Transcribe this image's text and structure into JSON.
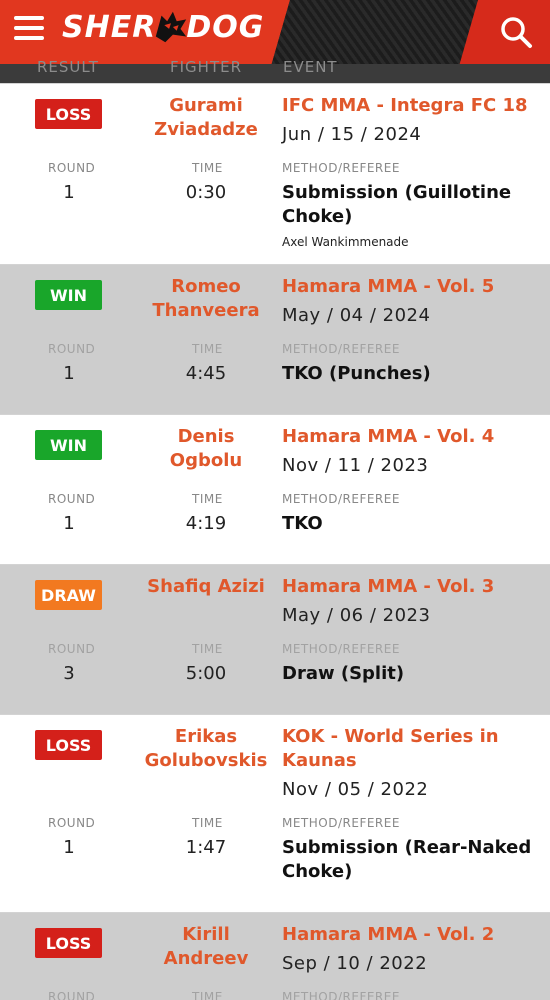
{
  "header": {
    "logo_left": "SHER",
    "logo_right": "DOG",
    "column_labels": [
      "RESULT",
      "FIGHTER",
      "EVENT"
    ]
  },
  "labels": {
    "round": "ROUND",
    "time": "TIME",
    "method_referee": "METHOD/REFEREE"
  },
  "colors": {
    "brand_red": "#e1371f",
    "loss": "#d4201a",
    "win": "#19a62a",
    "draw": "#f27920",
    "link_orange": "#e0582b"
  },
  "fights": [
    {
      "result": "LOSS",
      "fighter": "Gurami Zviadadze",
      "event": "IFC MMA - Integra FC 18",
      "date": "Jun / 15 / 2024",
      "round": "1",
      "time": "0:30",
      "method": "Submission (Guillotine Choke)",
      "referee": "Axel Wankimmenade"
    },
    {
      "result": "WIN",
      "fighter": "Romeo Thanveera",
      "event": "Hamara MMA - Vol. 5",
      "date": "May / 04 / 2024",
      "round": "1",
      "time": "4:45",
      "method": "TKO (Punches)",
      "referee": ""
    },
    {
      "result": "WIN",
      "fighter": "Denis Ogbolu",
      "event": "Hamara MMA - Vol. 4",
      "date": "Nov / 11 / 2023",
      "round": "1",
      "time": "4:19",
      "method": "TKO",
      "referee": ""
    },
    {
      "result": "DRAW",
      "fighter": "Shafiq Azizi",
      "event": "Hamara MMA - Vol. 3",
      "date": "May / 06 / 2023",
      "round": "3",
      "time": "5:00",
      "method": "Draw (Split)",
      "referee": ""
    },
    {
      "result": "LOSS",
      "fighter": "Erikas Golubovskis",
      "event": "KOK - World Series in Kaunas",
      "date": "Nov / 05 / 2022",
      "round": "1",
      "time": "1:47",
      "method": "Submission (Rear-Naked Choke)",
      "referee": ""
    },
    {
      "result": "LOSS",
      "fighter": "Kirill Andreev",
      "event": "Hamara MMA - Vol. 2",
      "date": "Sep / 10 / 2022",
      "round": "",
      "time": "",
      "method": "",
      "referee": ""
    }
  ]
}
